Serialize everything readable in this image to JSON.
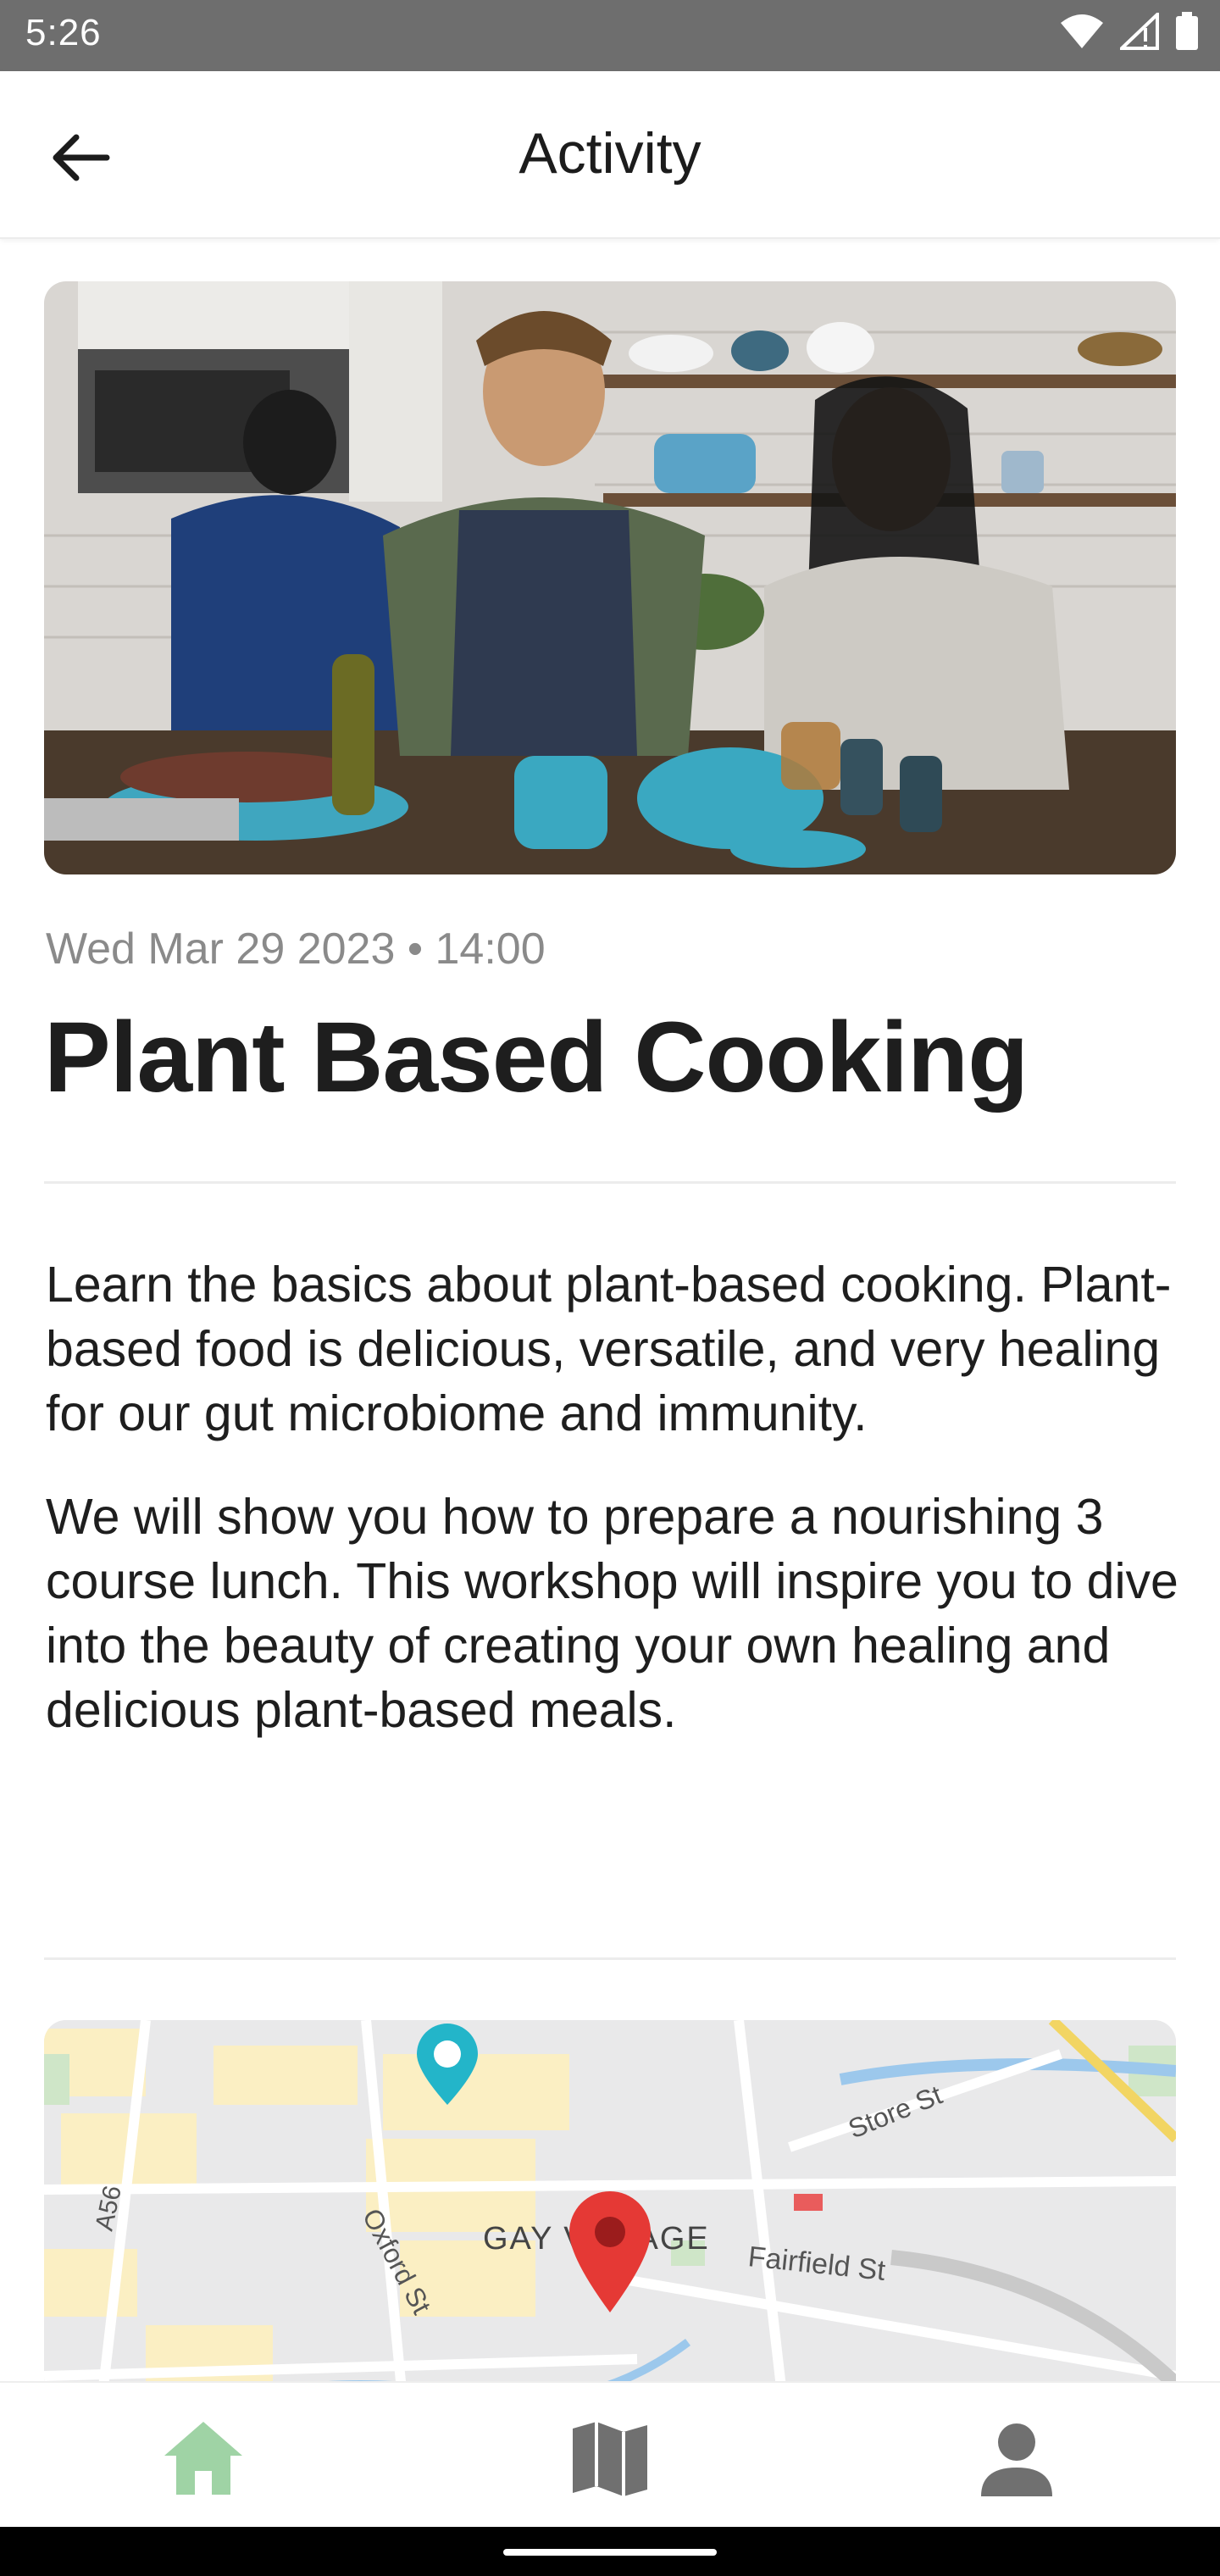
{
  "status_bar": {
    "time": "5:26",
    "icons": [
      "wifi-icon",
      "signal-icon",
      "battery-icon"
    ]
  },
  "app_bar": {
    "title": "Activity",
    "back_icon": "arrow-left-icon"
  },
  "event": {
    "image": "people-cooking-in-kitchen-photo",
    "datetime": "Wed Mar 29 2023 • 14:00",
    "title": "Plant Based Cooking",
    "description": [
      "Learn the basics about plant-based cooking. Plant-based food is delicious, versatile, and very healing for our gut microbiome and immunity.",
      "We will show you how to prepare a nourishing 3 course lunch. This workshop will inspire you to dive into the beauty of creating your own healing and delicious plant-based meals."
    ]
  },
  "map": {
    "labels": {
      "street1": "Store St",
      "street2": "Fairfield St",
      "street3": "Oxford St",
      "road": "A56",
      "area": "GAY VILLAGE"
    }
  },
  "bottom_nav": {
    "items": [
      {
        "icon": "home-icon",
        "active": true
      },
      {
        "icon": "map-icon",
        "active": false
      },
      {
        "icon": "person-icon",
        "active": false
      }
    ],
    "active_color": "#9fd3a5",
    "inactive_color": "#707070"
  }
}
